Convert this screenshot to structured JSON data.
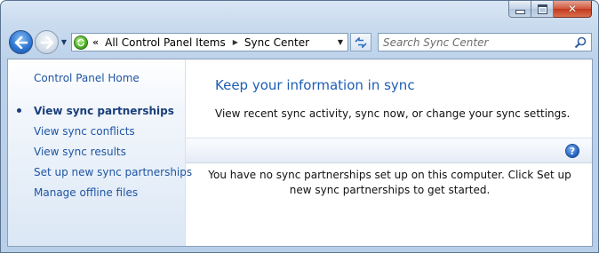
{
  "window": {
    "caption_close": "✕"
  },
  "nav": {
    "breadcrumb": [
      "All Control Panel Items",
      "Sync Center"
    ],
    "crumb_overflow": "«",
    "search_placeholder": "Search Sync Center"
  },
  "sidebar": {
    "home_link": "Control Panel Home",
    "tasks": [
      {
        "label": "View sync partnerships",
        "active": true
      },
      {
        "label": "View sync conflicts",
        "active": false
      },
      {
        "label": "View sync results",
        "active": false
      },
      {
        "label": "Set up new sync partnerships",
        "active": false
      },
      {
        "label": "Manage offline files",
        "active": false
      }
    ]
  },
  "main": {
    "title": "Keep your information in sync",
    "description": "View recent sync activity, sync now, or change your sync settings.",
    "empty_message": "You have no sync partnerships set up on this computer. Click Set up new sync partnerships to get started.",
    "help_glyph": "?"
  },
  "colors": {
    "link": "#1f55a3",
    "title": "#1e5db3",
    "close_button": "#c2391d"
  }
}
